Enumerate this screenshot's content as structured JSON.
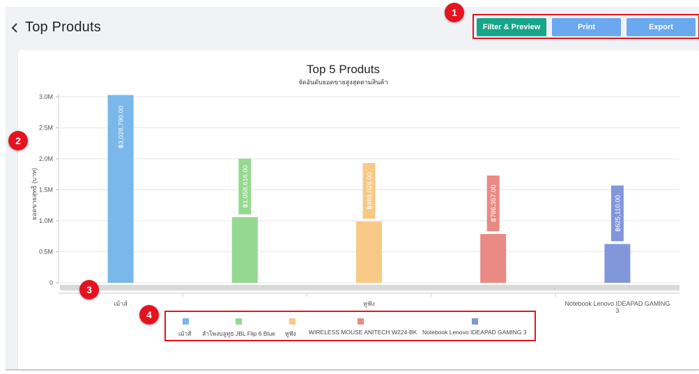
{
  "header": {
    "title": "Top Produts",
    "buttons": {
      "filter_label": "Filter & Preview",
      "print_label": "Print",
      "export_label": "Export"
    }
  },
  "markers": [
    "1",
    "2",
    "3",
    "4"
  ],
  "colors": {
    "accent_red": "#e4131f",
    "filter_button": "#17a589",
    "primary_button": "#6aa9f0"
  },
  "chart_data": {
    "type": "bar",
    "title": "Top 5 Produts",
    "subtitle": "จัดอันดับยอดขายสูงสุดตามสินค้า",
    "ylabel": "ยอดขายสุทธิ (บาท)",
    "xlabel": "",
    "ylim": [
      0,
      3000000
    ],
    "yticks": [
      "0",
      "0.5M",
      "1.0M",
      "1.5M",
      "2.0M",
      "2.5M",
      "3.0M"
    ],
    "ytick_values": [
      0,
      500000,
      1000000,
      1500000,
      2000000,
      2500000,
      3000000
    ],
    "grid": true,
    "legend_position": "bottom",
    "categories": [
      "เม้าส์",
      "ลำโพงบลูทูธ JBL Flip 6 Blue",
      "หูฟัง",
      "WIRELESS MOUSE ANITECH W224-BK",
      "Notebook Lenovo IDEAPAD GAMING 3"
    ],
    "x_tick_labels": [
      "เม้าส์",
      "",
      "หูฟัง",
      "",
      "Notebook Lenovo IDEAPAD GAMING 3"
    ],
    "values": [
      3028790,
      1058616,
      988026,
      786357,
      625110
    ],
    "value_labels": [
      "฿3,028,790.00",
      "฿1,058,616.00",
      "฿988,026.00",
      "฿786,357.00",
      "฿625,110.00"
    ],
    "colors": [
      "#7ab7ea",
      "#95d890",
      "#f8c987",
      "#e98a85",
      "#8296db"
    ]
  }
}
